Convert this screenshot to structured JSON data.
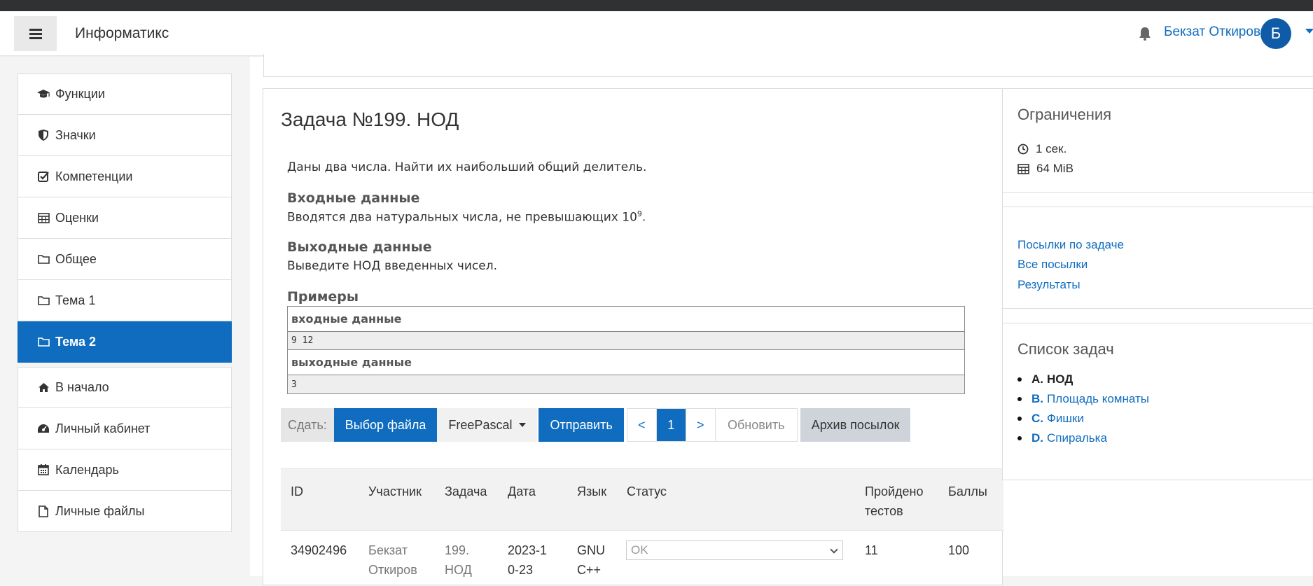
{
  "header": {
    "brand": "Информатикс",
    "user_name": "Бекзат Откиров",
    "avatar_letter": "Б"
  },
  "sidebar": {
    "items": [
      {
        "label": "Функции",
        "icon": "graduation-cap-icon"
      },
      {
        "label": "Значки",
        "icon": "shield-icon"
      },
      {
        "label": "Компетенции",
        "icon": "checkbox-icon"
      },
      {
        "label": "Оценки",
        "icon": "table-icon"
      },
      {
        "label": "Общее",
        "icon": "folder-icon"
      },
      {
        "label": "Тема 1",
        "icon": "folder-icon"
      },
      {
        "label": "Тема 2",
        "icon": "folder-icon",
        "active": true
      }
    ],
    "items2": [
      {
        "label": "В начало",
        "icon": "home-icon"
      },
      {
        "label": "Личный кабинет",
        "icon": "dashboard-icon"
      },
      {
        "label": "Календарь",
        "icon": "calendar-icon"
      },
      {
        "label": "Личные файлы",
        "icon": "file-icon"
      }
    ]
  },
  "problem": {
    "title": "Задача №199. НОД",
    "statement": "Даны два числа. Найти их наибольший общий делитель.",
    "input_heading": "Входные данные",
    "input_text": "Вводятся два натуральных числа, не превышающих 10",
    "input_exp": "9",
    "input_tail": ".",
    "output_heading": "Выходные данные",
    "output_text": "Выведите НОД введенных чисел.",
    "examples_heading": "Примеры",
    "sample_input_label": "входные данные",
    "sample_input": "9 12",
    "sample_output_label": "выходные данные",
    "sample_output": "3"
  },
  "submit": {
    "label": "Сдать:",
    "choose_file": "Выбор файла",
    "language": "FreePascal",
    "send": "Отправить",
    "prev": "<",
    "page": "1",
    "next": ">",
    "refresh": "Обновить",
    "archive": "Архив посылок"
  },
  "results": {
    "headers": [
      "ID",
      "Участник",
      "Задача",
      "Дата",
      "Язык",
      "Статус",
      "Пройдено тестов",
      "Баллы"
    ],
    "row": {
      "id": "34902496",
      "participant": "Бекзат Откиров",
      "task": "199. НОД",
      "date": "2023-10-23",
      "language": "GNU C++",
      "status": "OK",
      "tests": "11",
      "score": "100"
    }
  },
  "limits": {
    "title": "Ограничения",
    "time": "1 сек.",
    "memory": "64 MiB"
  },
  "links": {
    "submissions_task": "Посылки по задаче",
    "all_submissions": "Все посылки",
    "results": "Результаты"
  },
  "tasks": {
    "title": "Список задач",
    "items": [
      {
        "letter": "A.",
        "name": "НОД",
        "current": true
      },
      {
        "letter": "B.",
        "name": "Площадь комнаты"
      },
      {
        "letter": "C.",
        "name": "Фишки"
      },
      {
        "letter": "D.",
        "name": "Спиралька"
      }
    ]
  },
  "colors": {
    "accent": "#0f6cbf",
    "avatar": "#0f5ba8",
    "topbar": "#2f3133"
  }
}
